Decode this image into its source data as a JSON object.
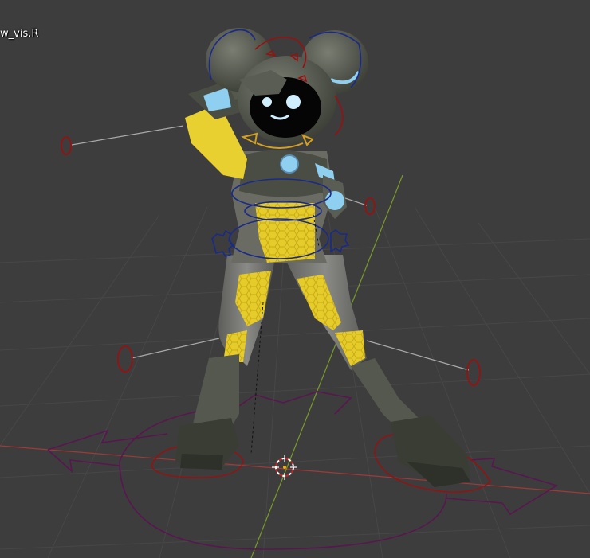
{
  "viewport": {
    "active_object_label": "w_vis.R",
    "colors": {
      "background": "#3d3d3d",
      "grid": "#474747",
      "x_axis": "#a03a3a",
      "y_axis": "#7a9a2a",
      "bone_blue": "#1a2a8a",
      "bone_red": "#9a1010",
      "bone_purple": "#5a1650",
      "bone_yellow": "#d4a020",
      "suit_gray": "#6e6e6a",
      "suit_dark": "#3c3f36",
      "suit_yellow": "#e8d030",
      "accent_cyan": "#8fd0f0"
    }
  }
}
